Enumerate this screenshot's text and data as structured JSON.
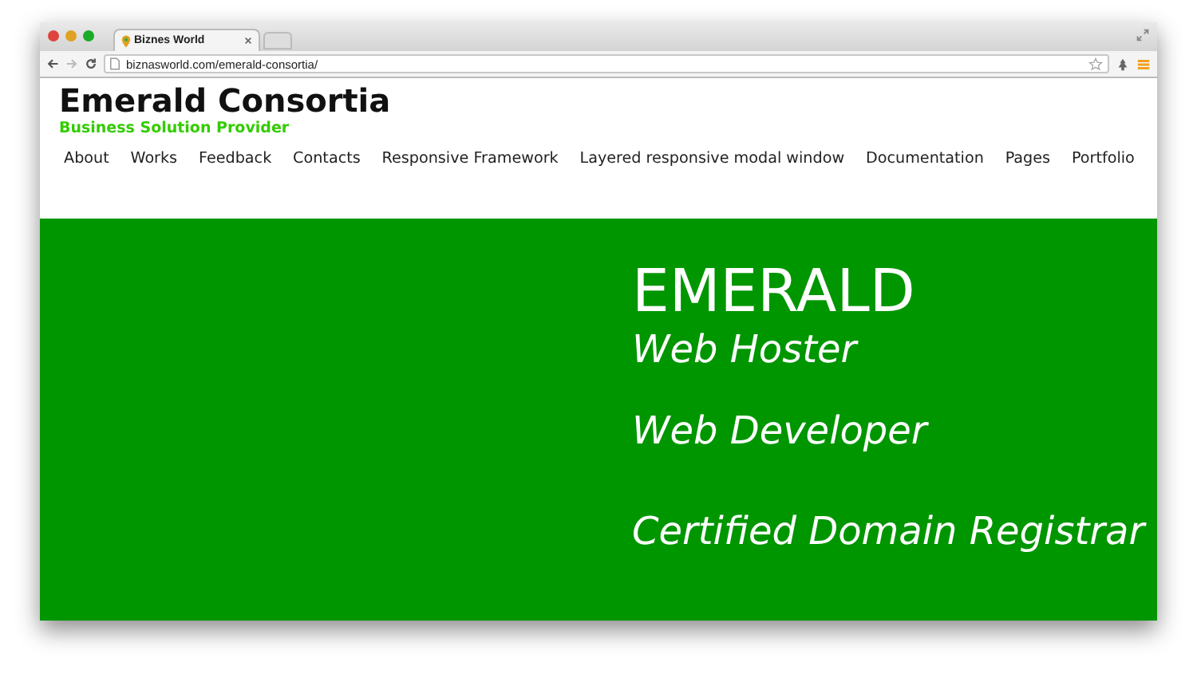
{
  "browser": {
    "tab_title": "Biznes World",
    "url": "biznasworld.com/emerald-consortia/"
  },
  "site": {
    "title": "Emerald Consortia",
    "tagline": "Business Solution Provider"
  },
  "nav": [
    "About",
    "Works",
    "Feedback",
    "Contacts",
    "Responsive Framework",
    "Layered responsive modal window",
    "Documentation",
    "Pages",
    "Portfolio"
  ],
  "hero": {
    "heading": "EMERALD",
    "lines": [
      "Web Hoster",
      "Web Developer",
      "Certified Domain Registrar"
    ]
  }
}
